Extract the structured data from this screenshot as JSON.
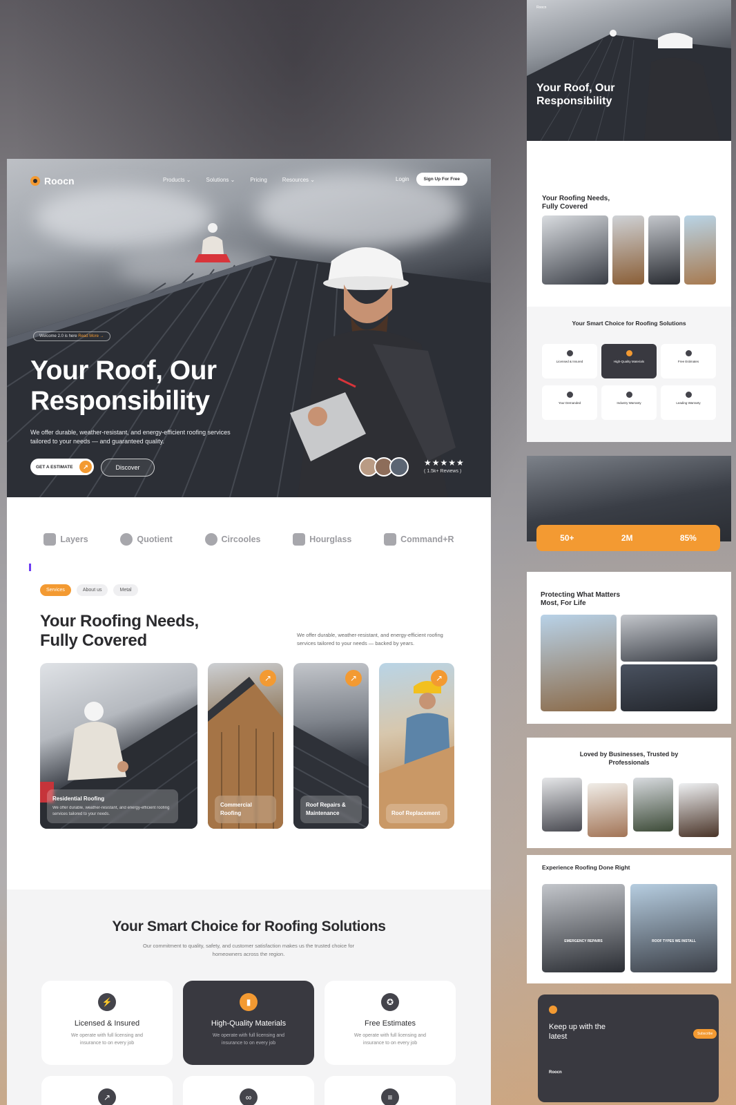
{
  "nav": {
    "brand": "Roocn",
    "links": [
      "Products ⌄",
      "Solutions ⌄",
      "Pricing",
      "Resources ⌄"
    ],
    "login": "Login",
    "signup": "Sign Up For Free"
  },
  "hero": {
    "badge_prefix": "Welcome 2.0 is here",
    "badge_link": "Read More →",
    "title": "Your Roof, Our Responsibility",
    "subtitle": "We offer durable, weather-resistant, and energy-efficient roofing services tailored to your needs — and guaranteed quality.",
    "cta_primary": "GET A ESTIMATE",
    "cta_secondary": "Discover",
    "stars": "★★★★★",
    "reviews": "( 1.5k+ Reviews )"
  },
  "brands": [
    "Layers",
    "Quotient",
    "Circooles",
    "Hourglass",
    "Command+R"
  ],
  "services": {
    "tabs": [
      "Services",
      "About us",
      "Metal"
    ],
    "title_line1": "Your Roofing Needs,",
    "title_line2": "Fully Covered",
    "description": "We offer durable, weather-resistant, and energy-efficient roofing services tailored to your needs — backed by years.",
    "cards": [
      {
        "title": "Residential Roofing",
        "text": "We offer durable, weather-resistant, and energy-efficient roofing services tailored to your needs."
      },
      {
        "title": "Commercial Roofing",
        "text": ""
      },
      {
        "title": "Roof Repairs & Maintenance",
        "text": ""
      },
      {
        "title": "Roof Replacement",
        "text": ""
      }
    ]
  },
  "smart": {
    "title": "Your Smart Choice for Roofing Solutions",
    "subtitle": "Our commitment to quality, safety, and customer satisfaction makes us the trusted choice for homeowners across the region.",
    "features": [
      {
        "title": "Licensed & Insured",
        "text": "We operate with full licensing and insurance to on every job"
      },
      {
        "title": "High-Quality Materials",
        "text": "We operate with full licensing and insurance to on every job"
      },
      {
        "title": "Free Estimates",
        "text": "We operate with full licensing and insurance to on every job"
      }
    ]
  },
  "preview": {
    "hero_title": "Your Roof, Our Responsibility",
    "services_title": "Your Roofing Needs, Fully Covered",
    "smart_title": "Your Smart Choice for Roofing Solutions",
    "mini_features": [
      "Licensed & Insured",
      "High-Quality Materials",
      "Free Estimates",
      "Your Demanded",
      "Industry Warranty",
      "Leading Warranty"
    ],
    "stats": [
      "50+",
      "2M",
      "85%"
    ],
    "protect_title": "Protecting What Matters Most, For Life",
    "loved_title": "Loved by Businesses, Trusted by Professionals",
    "experience_title": "Experience Roofing Done Right",
    "experience_cards": [
      "EMERGENCY REPAIRS",
      "ROOF TYPES WE INSTALL"
    ],
    "newsletter_title": "Keep up with the latest",
    "subscribe": "Subscribe",
    "footer_brand": "Roocn"
  },
  "colors": {
    "accent": "#f39a32",
    "dark": "#393940"
  }
}
